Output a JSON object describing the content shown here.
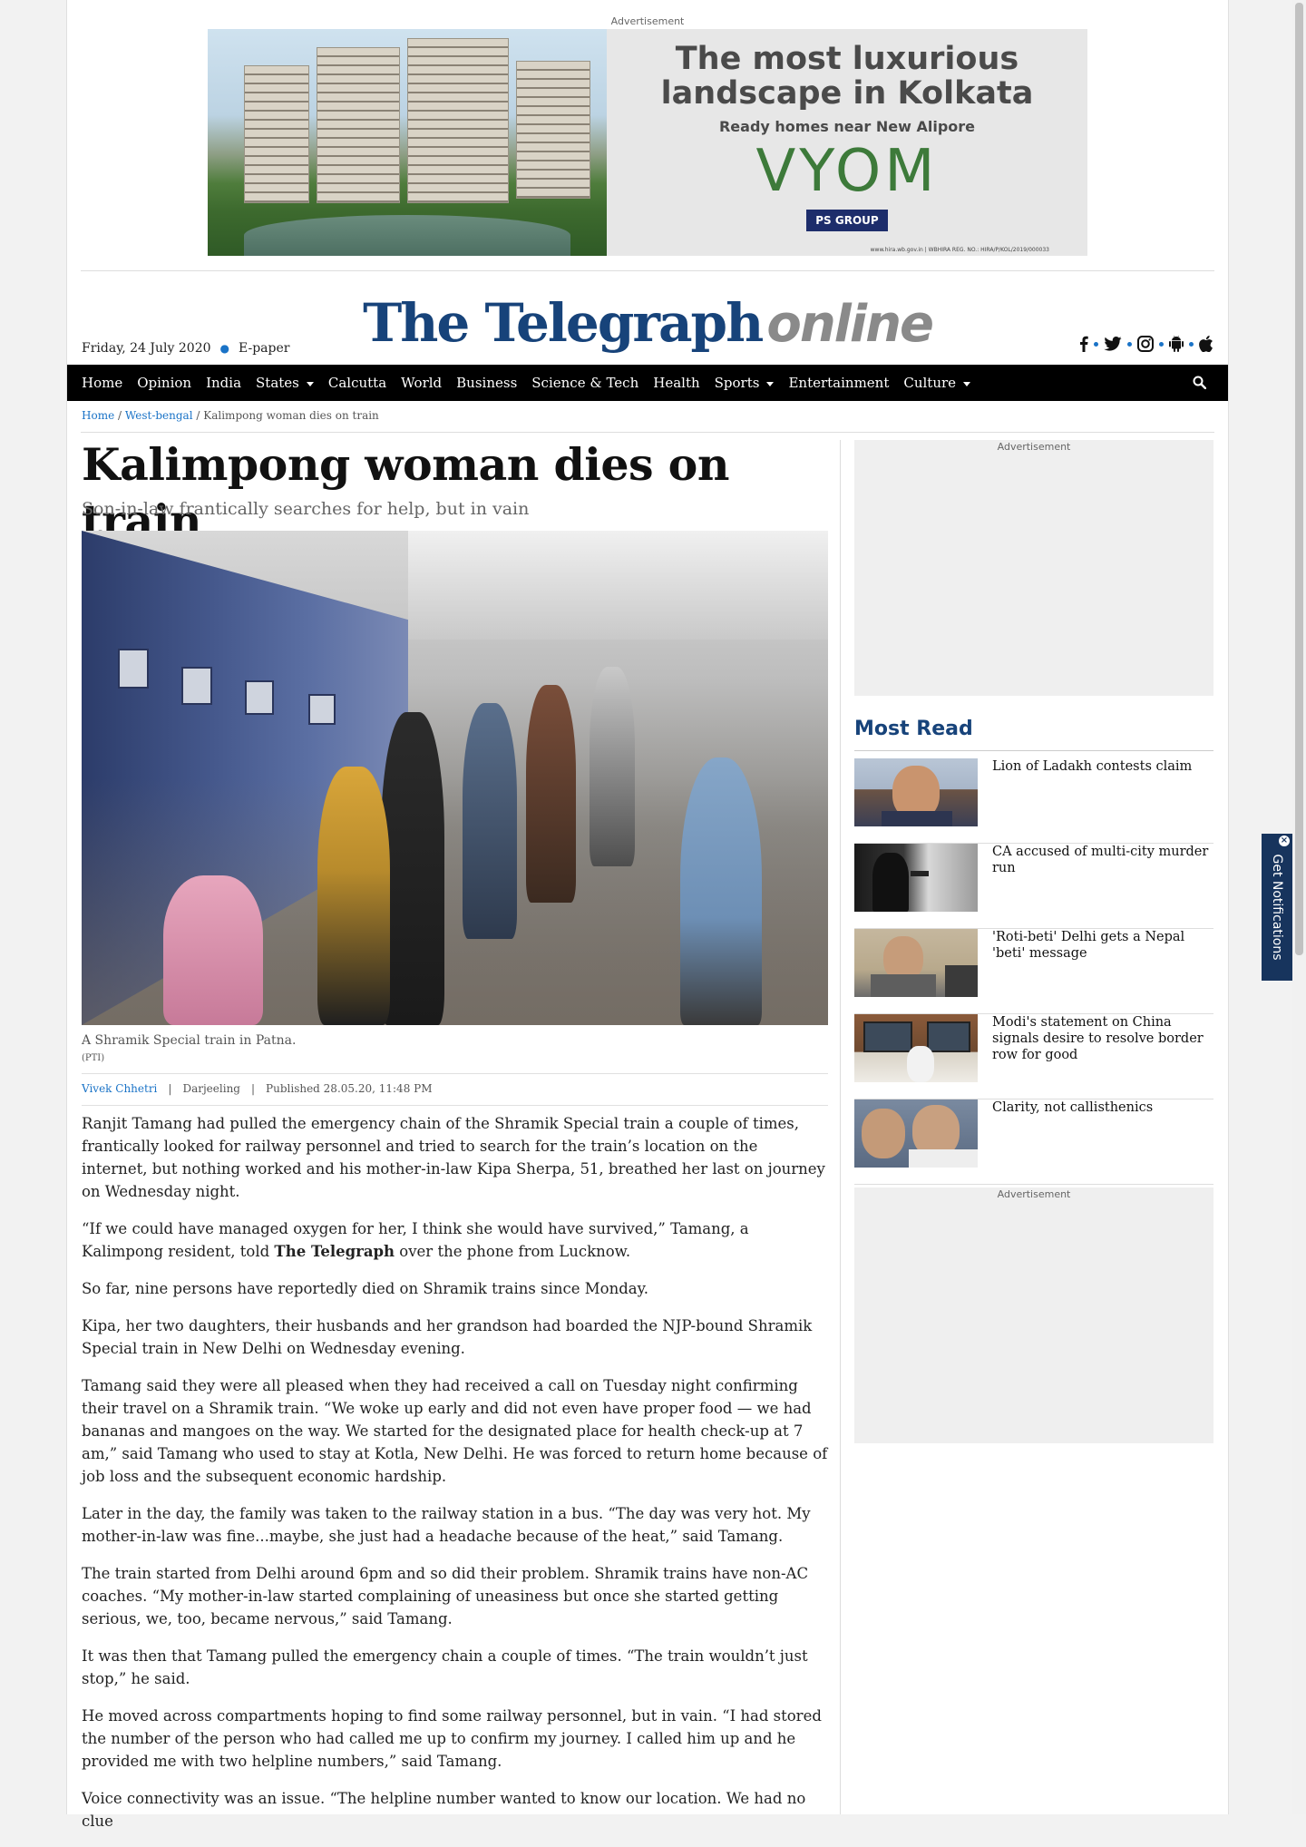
{
  "ad_top": {
    "label": "Advertisement",
    "headline": "The most luxurious landscape in Kolkata",
    "subline": "Ready homes near New Alipore",
    "brand": "VYOM",
    "logo": "PS GROUP",
    "fine_print": "www.hira.wb.gov.in | WBHIRA REG. NO.: HIRA/P/KOL/2019/000033"
  },
  "masthead": {
    "title": "The Telegraph",
    "suffix": "online"
  },
  "dateline": {
    "date": "Friday, 24 July 2020",
    "epaper": "E-paper"
  },
  "social": [
    "facebook-icon",
    "twitter-icon",
    "instagram-icon",
    "android-icon",
    "apple-icon"
  ],
  "nav": {
    "items": [
      {
        "label": "Home"
      },
      {
        "label": "Opinion"
      },
      {
        "label": "India"
      },
      {
        "label": "States"
      },
      {
        "label": "Calcutta"
      },
      {
        "label": "World"
      },
      {
        "label": "Business"
      },
      {
        "label": "Science & Tech"
      },
      {
        "label": "Health"
      },
      {
        "label": "Sports"
      },
      {
        "label": "Entertainment"
      },
      {
        "label": "Culture"
      }
    ]
  },
  "breadcrumb": {
    "home": "Home",
    "section": "West-bengal",
    "current": "Kalimpong woman dies on train",
    "sep": "/"
  },
  "article": {
    "headline": "Kalimpong woman dies on train",
    "standfirst": "Son-in-law frantically searches for help, but in vain",
    "caption": "A Shramik Special train in Patna.",
    "credit": "(PTI)",
    "author": "Vivek Chhetri",
    "location": "Darjeeling",
    "published": "Published 28.05.20, 11:48 PM",
    "sep": "|",
    "p1": "Ranjit Tamang had pulled the emergency chain of the Shramik Special train a couple of times, frantically looked for railway personnel and tried to search for the train’s location on the internet, but nothing worked and his mother-in-law Kipa Sherpa, 51, breathed her last on journey on Wednesday night.",
    "p2a": "“If we could have managed oxygen for her, I think she would have survived,” Tamang, a Kalimpong resident, told ",
    "p2b": "The Telegraph",
    "p2c": " over the phone from Lucknow.",
    "p3": "So far, nine persons have reportedly died on Shramik trains since Monday.",
    "p4": "Kipa, her two daughters, their husbands and her grandson had boarded the NJP-bound Shramik Special train in New Delhi on Wednesday evening.",
    "p5": "Tamang said they were all pleased when they had received a call on Tuesday night confirming their travel on a Shramik train. “We woke up early and did not even have proper food — we had bananas and mangoes on the way. We started for the designated place for health check-up at 7 am,” said Tamang who used to stay at Kotla, New Delhi. He was forced to return home because of job loss and the subsequent economic hardship.",
    "p6": "Later in the day, the family was taken to the railway station in a bus. “The day was very hot. My mother-in-law was fine...maybe, she just had a headache because of the heat,” said Tamang.",
    "p7": "The train started from Delhi around 6pm and so did their problem. Shramik trains have non-AC coaches. “My mother-in-law started complaining of uneasiness but once she started getting serious, we, too, became nervous,” said Tamang.",
    "p8": "It was then that Tamang pulled the emergency chain a couple of times. “The train wouldn’t just stop,” he said.",
    "p9": "He moved across compartments hoping to find some railway personnel, but in vain. “I had stored the number of the person who had called me up to confirm my journey. I called him up and he provided me with two helpline numbers,” said Tamang.",
    "p10": "Voice connectivity was an issue. “The helpline number wanted to know our location. We had no clue"
  },
  "sidebar": {
    "ad_label": "Advertisement",
    "most_read_title": "Most Read",
    "most_read": [
      {
        "title": "Lion of Ladakh contests claim"
      },
      {
        "title": "CA accused of multi-city murder run"
      },
      {
        "title": "'Roti-beti' Delhi gets a Nepal 'beti' message"
      },
      {
        "title": "Modi's statement on China signals desire to resolve border row for good"
      },
      {
        "title": "Clarity, not callisthenics"
      }
    ]
  },
  "notifications": {
    "label": "Get Notifications"
  }
}
